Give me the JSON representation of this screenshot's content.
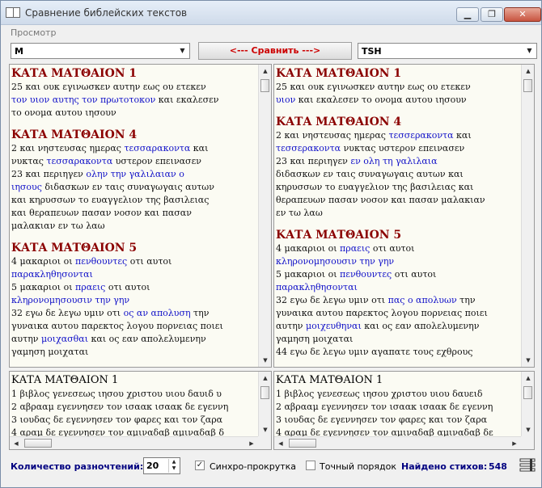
{
  "window": {
    "title": "Сравнение библейских текстов",
    "controls": [
      "▁",
      "❐",
      "✕"
    ]
  },
  "menu": [
    "Просмотр"
  ],
  "toolbar": {
    "left_version": "M",
    "compare_label": "<--- Сравнить --->",
    "right_version": "TSH"
  },
  "top_left": [
    {
      "h": "ΚΑΤΑ ΜΑΤΘΑΙΟΝ 1"
    },
    {
      "l": [
        [
          " 25 και ουκ εγινωσκεν αυτην εως ου ετεκεν",
          0
        ]
      ]
    },
    {
      "l": [
        [
          "τον υιον αυτης τον πρωτοτοκον",
          1
        ],
        [
          " και εκαλεσεν",
          0
        ]
      ]
    },
    {
      "l": [
        [
          "το ονομα αυτου ιησουν",
          0
        ]
      ]
    },
    {
      "h": "ΚΑΤΑ ΜΑΤΘΑΙΟΝ 4"
    },
    {
      "l": [
        [
          " 2 και νηστευσας ημερας ",
          0
        ],
        [
          "τεσσαρακοντα",
          1
        ],
        [
          " και",
          0
        ]
      ]
    },
    {
      "l": [
        [
          "νυκτας ",
          0
        ],
        [
          "τεσσαρακοντα",
          1
        ],
        [
          " υστερον επεινασεν",
          0
        ]
      ]
    },
    {
      "l": [
        [
          " 23 και περιηγεν ",
          0
        ],
        [
          "ολην την γαλιλαιαν ο",
          1
        ]
      ]
    },
    {
      "l": [
        [
          "ιησους",
          1
        ],
        [
          " διδασκων εν ταις συναγωγαις αυτων",
          0
        ]
      ]
    },
    {
      "l": [
        [
          "και κηρυσσων το ευαγγελιον της βασιλειας",
          0
        ]
      ]
    },
    {
      "l": [
        [
          "και θεραπευων πασαν νοσον και πασαν",
          0
        ]
      ]
    },
    {
      "l": [
        [
          "μαλακιαν εν τω λαω",
          0
        ]
      ]
    },
    {
      "h": "ΚΑΤΑ ΜΑΤΘΑΙΟΝ 5"
    },
    {
      "l": [
        [
          " 4 μακαριοι οι ",
          0
        ],
        [
          "πενθουντες",
          1
        ],
        [
          " οτι αυτοι",
          0
        ]
      ]
    },
    {
      "l": [
        [
          "παρακληθησονται",
          1
        ]
      ]
    },
    {
      "l": [
        [
          " 5 μακαριοι οι ",
          0
        ],
        [
          "πραεις",
          1
        ],
        [
          " οτι αυτοι",
          0
        ]
      ]
    },
    {
      "l": [
        [
          "κληρονομησουσιν την γην",
          1
        ]
      ]
    },
    {
      "l": [
        [
          " 32 εγω δε λεγω υμιν οτι ",
          0
        ],
        [
          "ος αν απολυση",
          1
        ],
        [
          " την",
          0
        ]
      ]
    },
    {
      "l": [
        [
          "γυναικα αυτου παρεκτος λογου πορνειας ποιει",
          0
        ]
      ]
    },
    {
      "l": [
        [
          "αυτην ",
          0
        ],
        [
          "μοιχασθαι",
          1
        ],
        [
          " και ος εαν απολελυμενην",
          0
        ]
      ]
    },
    {
      "l": [
        [
          "γαμηση μοιχαται",
          0
        ]
      ]
    }
  ],
  "top_right": [
    {
      "h": "ΚΑΤΑ ΜΑΤΘΑΙΟΝ 1"
    },
    {
      "l": [
        [
          " 25 και ουκ εγινωσκεν αυτην εως ου ετεκεν",
          0
        ]
      ]
    },
    {
      "l": [
        [
          "υιον",
          1
        ],
        [
          " και εκαλεσεν το ονομα αυτου ιησουν",
          0
        ]
      ]
    },
    {
      "h": "ΚΑΤΑ ΜΑΤΘΑΙΟΝ 4"
    },
    {
      "l": [
        [
          " 2 και νηστευσας ημερας ",
          0
        ],
        [
          "τεσσερακοντα",
          1
        ],
        [
          " και",
          0
        ]
      ]
    },
    {
      "l": [
        [
          "τεσσερακοντα",
          1
        ],
        [
          " νυκτας υστερον επεινασεν",
          0
        ]
      ]
    },
    {
      "l": [
        [
          " 23 και περιηγεν ",
          0
        ],
        [
          "εν ολη τη γαλιλαια",
          1
        ]
      ]
    },
    {
      "l": [
        [
          "διδασκων εν ταις συναγωγαις αυτων και",
          0
        ]
      ]
    },
    {
      "l": [
        [
          "κηρυσσων το ευαγγελιον της βασιλειας και",
          0
        ]
      ]
    },
    {
      "l": [
        [
          "θεραπευων πασαν νοσον και πασαν μαλακιαν",
          0
        ]
      ]
    },
    {
      "l": [
        [
          "εν τω λαω",
          0
        ]
      ]
    },
    {
      "h": "ΚΑΤΑ ΜΑΤΘΑΙΟΝ 5"
    },
    {
      "l": [
        [
          " 4 μακαριοι οι ",
          0
        ],
        [
          "πραεις",
          1
        ],
        [
          " οτι αυτοι",
          0
        ]
      ]
    },
    {
      "l": [
        [
          "κληρονομησουσιν την γην",
          1
        ]
      ]
    },
    {
      "l": [
        [
          " 5 μακαριοι οι ",
          0
        ],
        [
          "πενθουντες",
          1
        ],
        [
          " οτι αυτοι",
          0
        ]
      ]
    },
    {
      "l": [
        [
          "παρακληθησονται",
          1
        ]
      ]
    },
    {
      "l": [
        [
          " 32 εγω δε λεγω υμιν οτι ",
          0
        ],
        [
          "πας ο απολυων",
          1
        ],
        [
          " την",
          0
        ]
      ]
    },
    {
      "l": [
        [
          "γυναικα αυτου παρεκτος λογου πορνειας ποιει",
          0
        ]
      ]
    },
    {
      "l": [
        [
          "αυτην ",
          0
        ],
        [
          "μοιχευθηναι",
          1
        ],
        [
          " και ος εαν απολελυμενην",
          0
        ]
      ]
    },
    {
      "l": [
        [
          "γαμηση μοιχαται",
          0
        ]
      ]
    },
    {
      "l": [
        [
          " 44 εγω δε λεγω υμιν αγαπατε τους εχθρους",
          0
        ]
      ]
    }
  ],
  "bottom_left": [
    {
      "h": "ΚΑΤΑ ΜΑΤΘΑΙΟΝ 1"
    },
    {
      "l": [
        [
          " 1 βιβλος γενεσεως ιησου χριστου υιου δαυιδ υ",
          0
        ]
      ]
    },
    {
      "l": [
        [
          " 2 αβρααμ εγεννησεν τον ισαακ ισαακ δε εγεννη",
          0
        ]
      ]
    },
    {
      "l": [
        [
          " 3 ιουδας δε εγεννησεν τον φαρες και τον ζαρα",
          0
        ]
      ]
    },
    {
      "l": [
        [
          " 4 αραμ δε εγεννησεν τον αμιναδαβ αμιναδαβ δ",
          0
        ]
      ]
    }
  ],
  "bottom_right": [
    {
      "h": "ΚΑΤΑ ΜΑΤΘΑΙΟΝ 1"
    },
    {
      "l": [
        [
          " 1 βιβλος γενεσεως ιησου χριστου υιου δαυειδ",
          0
        ]
      ]
    },
    {
      "l": [
        [
          " 2 αβρααμ εγεννησεν τον ισαακ ισαακ δε εγεννη",
          0
        ]
      ]
    },
    {
      "l": [
        [
          " 3 ιουδας δε εγεννησεν τον φαρες και τον ζαρα",
          0
        ]
      ]
    },
    {
      "l": [
        [
          " 4 αραμ δε εγεννησεν τον αμιναδαβ αμιναδαβ δε",
          0
        ]
      ]
    }
  ],
  "status": {
    "variants_label": "Количество разночтений:",
    "variants_value": "20",
    "sync_label": "Синхро-прокрутка",
    "sync_checked": true,
    "exact_label": "Точный порядок",
    "exact_checked": false,
    "found_label": "Найдено стихов:",
    "found_value": "548"
  },
  "colors": {
    "heading": "#8b0000",
    "difference": "#1010c8",
    "status_label": "#000080"
  }
}
